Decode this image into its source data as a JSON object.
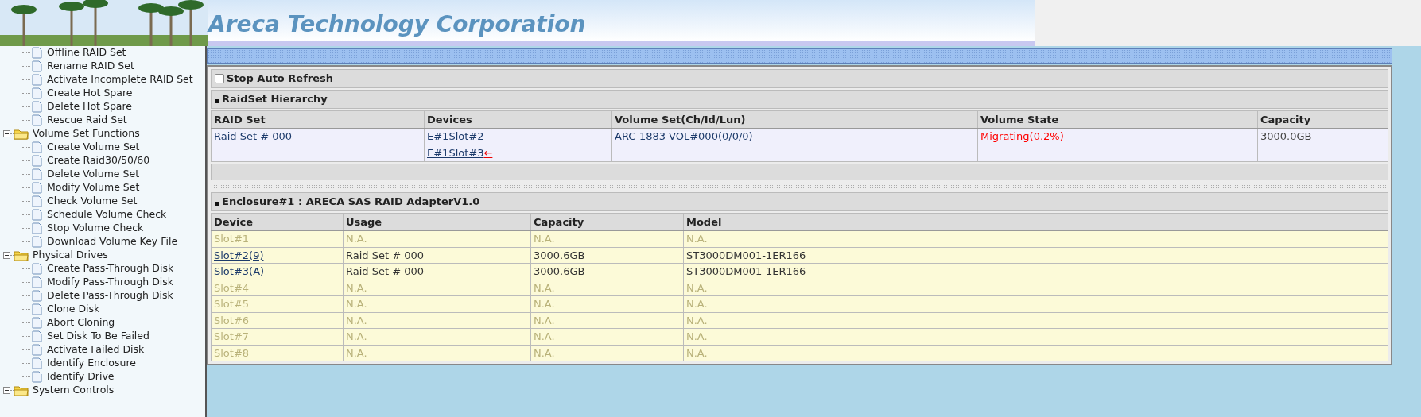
{
  "header": {
    "title": "Areca Technology Corporation"
  },
  "sidebar": {
    "items": [
      {
        "children": [
          {
            "label": "Offline RAID Set"
          },
          {
            "label": "Rename RAID Set"
          },
          {
            "label": "Activate Incomplete RAID Set"
          },
          {
            "label": "Create Hot Spare"
          },
          {
            "label": "Delete Hot Spare"
          },
          {
            "label": "Rescue Raid Set"
          }
        ]
      },
      {
        "label": "Volume Set Functions",
        "expanded": true,
        "children": [
          {
            "label": "Create Volume Set"
          },
          {
            "label": "Create Raid30/50/60"
          },
          {
            "label": "Delete Volume Set"
          },
          {
            "label": "Modify Volume Set"
          },
          {
            "label": "Check Volume Set"
          },
          {
            "label": "Schedule Volume Check"
          },
          {
            "label": "Stop Volume Check"
          },
          {
            "label": "Download Volume Key File"
          }
        ]
      },
      {
        "label": "Physical Drives",
        "expanded": true,
        "children": [
          {
            "label": "Create Pass-Through Disk"
          },
          {
            "label": "Modify Pass-Through Disk"
          },
          {
            "label": "Delete Pass-Through Disk"
          },
          {
            "label": "Clone Disk"
          },
          {
            "label": "Abort Cloning"
          },
          {
            "label": "Set Disk To Be Failed"
          },
          {
            "label": "Activate Failed Disk"
          },
          {
            "label": "Identify Enclosure"
          },
          {
            "label": "Identify Drive"
          }
        ]
      },
      {
        "label": "System Controls",
        "expanded": true
      }
    ]
  },
  "auto_refresh": {
    "label": "Stop Auto Refresh",
    "checked": false
  },
  "raidset": {
    "title": "RaidSet Hierarchy",
    "columns": [
      "RAID Set",
      "Devices",
      "Volume Set(Ch/Id/Lun)",
      "Volume State",
      "Capacity"
    ],
    "rows": [
      {
        "raid_set": "Raid Set # 000",
        "device": "E#1Slot#2",
        "volume_set": "ARC-1883-VOL#000(0/0/0)",
        "volume_state": "Migrating(0.2%)",
        "capacity": "3000.0GB"
      },
      {
        "device": "E#1Slot#3",
        "marker": "←"
      }
    ]
  },
  "enclosure": {
    "title": "Enclosure#1 : ARECA SAS RAID AdapterV1.0",
    "columns": [
      "Device",
      "Usage",
      "Capacity",
      "Model"
    ],
    "rows": [
      {
        "device": "Slot#1",
        "usage": "N.A.",
        "capacity": "N.A.",
        "model": "N.A.",
        "occupied": false
      },
      {
        "device": "Slot#2(9)",
        "usage": "Raid Set # 000",
        "capacity": "3000.6GB",
        "model": "ST3000DM001-1ER166",
        "occupied": true
      },
      {
        "device": "Slot#3(A)",
        "usage": "Raid Set # 000",
        "capacity": "3000.6GB",
        "model": "ST3000DM001-1ER166",
        "occupied": true
      },
      {
        "device": "Slot#4",
        "usage": "N.A.",
        "capacity": "N.A.",
        "model": "N.A.",
        "occupied": false
      },
      {
        "device": "Slot#5",
        "usage": "N.A.",
        "capacity": "N.A.",
        "model": "N.A.",
        "occupied": false
      },
      {
        "device": "Slot#6",
        "usage": "N.A.",
        "capacity": "N.A.",
        "model": "N.A.",
        "occupied": false
      },
      {
        "device": "Slot#7",
        "usage": "N.A.",
        "capacity": "N.A.",
        "model": "N.A.",
        "occupied": false
      },
      {
        "device": "Slot#8",
        "usage": "N.A.",
        "capacity": "N.A.",
        "model": "N.A.",
        "occupied": false
      }
    ]
  }
}
